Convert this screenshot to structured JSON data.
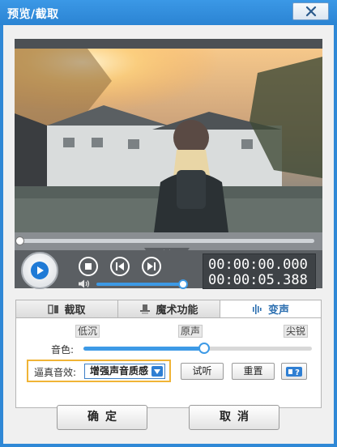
{
  "window": {
    "title": "预览/截取"
  },
  "player": {
    "current_time": "00:00:00.000",
    "total_time": "00:00:05.388",
    "progress_fraction": 0.0,
    "volume_fraction": 1.0
  },
  "tabs": [
    {
      "label": "截取",
      "icon": "crop-icon",
      "active": false
    },
    {
      "label": "魔术功能",
      "icon": "magic-hat-icon",
      "active": false
    },
    {
      "label": "变声",
      "icon": "waveform-icon",
      "active": true
    }
  ],
  "voice": {
    "pitch_low": "低沉",
    "pitch_mid": "原声",
    "pitch_high": "尖锐",
    "timbre_label": "音色:",
    "timbre_fraction": 0.53,
    "effect_label": "逼真音效:",
    "effect_value": "增强声音质感",
    "listen_label": "试听",
    "reset_label": "重置"
  },
  "footer": {
    "ok_label": "确定",
    "cancel_label": "取消"
  },
  "colors": {
    "accent": "#3d9ae6",
    "highlight_border": "#f0b436",
    "titlebar": "#2f88d6"
  }
}
